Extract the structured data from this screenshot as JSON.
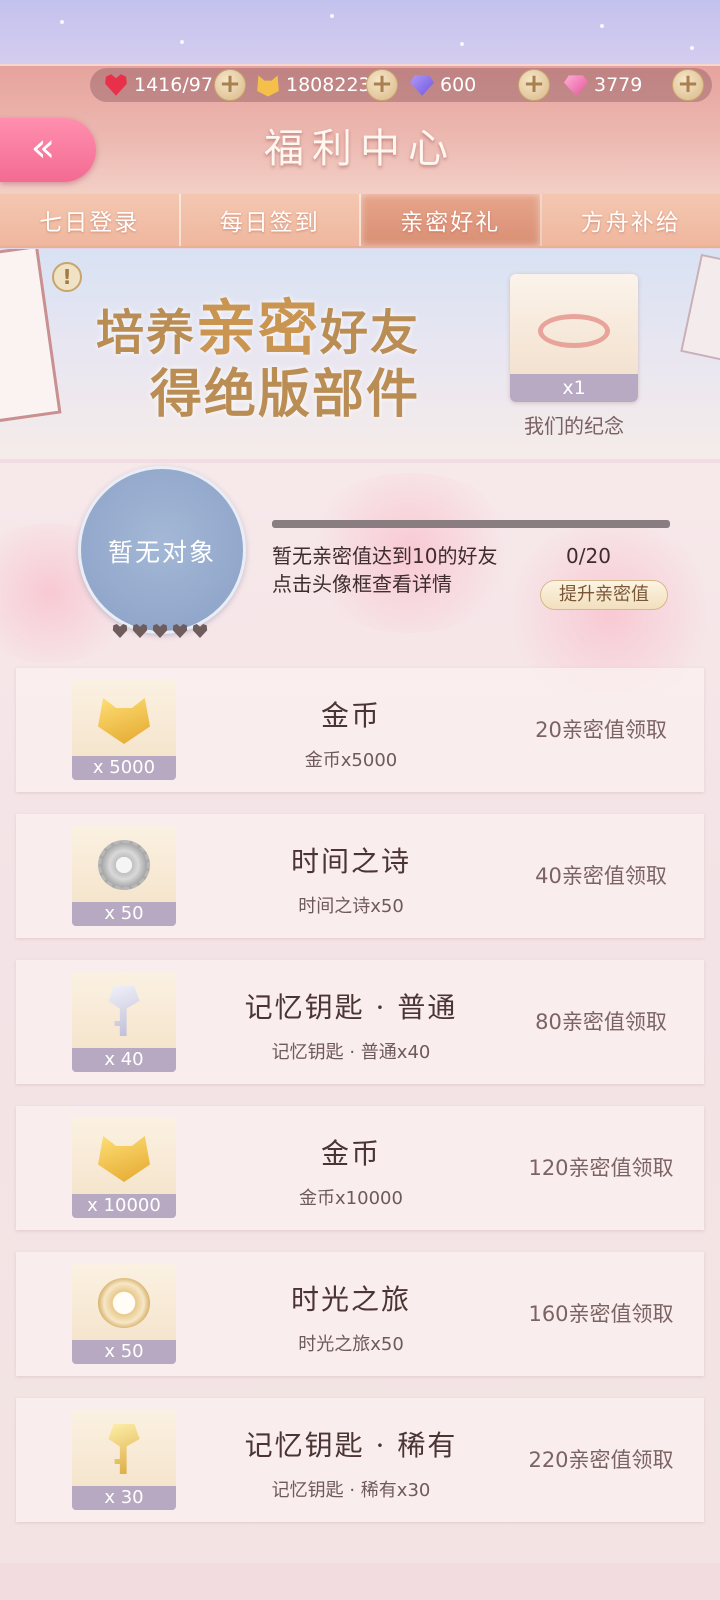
{
  "resources": {
    "stamina": "1416/97",
    "gold": "1808223",
    "diamonds": "600",
    "pink_diamonds": "3779"
  },
  "header": {
    "back_label": "«",
    "title": "福利中心"
  },
  "tabs": [
    {
      "label": "七日登录"
    },
    {
      "label": "每日签到"
    },
    {
      "label": "亲密好礼",
      "active": true
    },
    {
      "label": "方舟补给"
    }
  ],
  "banner": {
    "line1_prefix": "培养",
    "line1_big": "亲密",
    "line1_suffix": "好友",
    "line2": "得绝版部件",
    "info_icon": "!",
    "reward": {
      "count": "x1",
      "label": "我们的纪念",
      "icon": "ring-icon"
    }
  },
  "friend": {
    "avatar_text": "暂无对象",
    "message_line1": "暂无亲密值达到10的好友",
    "message_line2": "点击头像框查看详情",
    "progress": "0/20",
    "progress_value": 0,
    "raise_button": "提升亲密值",
    "hearts": 5
  },
  "rewards": [
    {
      "name": "金币",
      "desc": "金币x5000",
      "count": "x 5000",
      "claim": "20亲密值领取",
      "icon": "coin-icon"
    },
    {
      "name": "时间之诗",
      "desc": "时间之诗x50",
      "count": "x 50",
      "claim": "40亲密值领取",
      "icon": "gear-icon"
    },
    {
      "name": "记忆钥匙 · 普通",
      "desc": "记忆钥匙 · 普通x40",
      "count": "x 40",
      "claim": "80亲密值领取",
      "icon": "silver-key-icon"
    },
    {
      "name": "金币",
      "desc": "金币x10000",
      "count": "x 10000",
      "claim": "120亲密值领取",
      "icon": "coin-icon"
    },
    {
      "name": "时光之旅",
      "desc": "时光之旅x50",
      "count": "x 50",
      "claim": "160亲密值领取",
      "icon": "clock-icon"
    },
    {
      "name": "记忆钥匙 · 稀有",
      "desc": "记忆钥匙 · 稀有x30",
      "count": "x 30",
      "claim": "220亲密值领取",
      "icon": "gold-key-icon"
    }
  ]
}
